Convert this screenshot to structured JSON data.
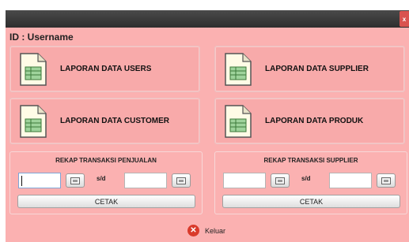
{
  "titlebar": {
    "close_glyph": "x"
  },
  "user": {
    "id_label": "ID : Username"
  },
  "buttons": {
    "users": "LAPORAN DATA USERS",
    "supplier": "LAPORAN DATA SUPPLIER",
    "customer": "LAPORAN DATA CUSTOMER",
    "produk": "LAPORAN DATA PRODUK"
  },
  "rekap_penjualan": {
    "title": "REKAP TRANSAKSI PENJUALAN",
    "from_value": "",
    "to_value": "",
    "separator": "s/d",
    "cetak_label": "CETAK"
  },
  "rekap_supplier": {
    "title": "REKAP TRANSAKSI SUPPLIER",
    "from_value": "",
    "to_value": "",
    "separator": "s/d",
    "cetak_label": "CETAK"
  },
  "keluar": {
    "label": "Keluar",
    "icon": "close-circle-icon"
  },
  "colors": {
    "window_bg": "#fbb1b1",
    "titlebar": "#3a3a3a",
    "close": "#d9534f",
    "exit_icon": "#d93a2b"
  }
}
